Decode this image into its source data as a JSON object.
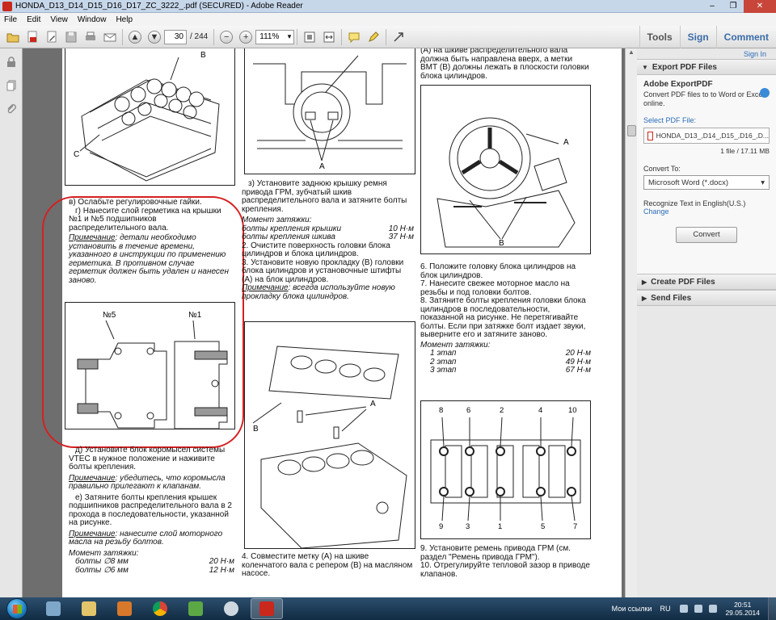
{
  "window": {
    "title": "HONDA_D13_D14_D15_D16_D17_ZC_3222_.pdf (SECURED) - Adobe Reader",
    "controls": [
      "–",
      "❐",
      "✕"
    ]
  },
  "menu": [
    "File",
    "Edit",
    "View",
    "Window",
    "Help"
  ],
  "toolbar": {
    "page_current": "30",
    "page_total": "/ 244",
    "zoom": "111%",
    "tools_label": "Tools",
    "sign_label": "Sign",
    "comment_label": "Comment"
  },
  "right_pane": {
    "sign_in": "Sign In",
    "export_header": "Export PDF Files",
    "export_title": "Adobe ExportPDF",
    "export_desc": "Convert PDF files to to Word or Excel online.",
    "select_label": "Select PDF File:",
    "file_name": "HONDA_D13_,D14_,D15_,D16_,D...",
    "file_count": "1 file / 17.11 MB",
    "convert_to_label": "Convert To:",
    "convert_to_value": "Microsoft Word (*.docx)",
    "recognize_text": "Recognize Text in English(U.S.)",
    "change_link": "Change",
    "convert_button": "Convert",
    "create_header": "Create PDF Files",
    "send_header": "Send Files"
  },
  "document": {
    "col1": {
      "fig_labels": [
        "В",
        "С"
      ],
      "p1": "в) Ослабьте регулировочные гайки.",
      "p2": "г) Нанесите слой герметика на крышки №1 и №5 подшипников распределительного вала.",
      "note1_label": "Примечание",
      "note1_text": ": детали необходимо установить в течение времени, указанного в инструкции по применению герметика. В противном случае герметик должен быть удален и нанесен заново.",
      "fig2_label_a": "№5",
      "fig2_label_b": "№1",
      "p3": "д) Установите блок коромысел системы VTEC в нужное положение и наживите болты крепления.",
      "note2_label": "Примечание",
      "note2_text": ": убедитесь, что коромысла правильно прилегают к клапанам.",
      "p4": "е) Затяните болты крепления крышек подшипников распределительного вала в 2 прохода в последовательности, указанной на рисунке.",
      "note3_label": "Примечание",
      "note3_text": ": нанесите слой моторного масла на резьбу болтов.",
      "torque_title": "Момент затяжки:",
      "torque_rows": [
        {
          "name": "болты ∅8 мм",
          "value": "20 Н·м"
        },
        {
          "name": "болты ∅6 мм",
          "value": "12 Н·м"
        }
      ]
    },
    "col2": {
      "fig_label_a": "A",
      "p1": "з) Установите заднюю крышку ремня привода ГРМ, зубчатый шкив распределительного вала и затяните болты крепления.",
      "torque_title": "Момент затяжки:",
      "torque_rows": [
        {
          "name": "болты крепления крышки",
          "value": "10 Н·м"
        },
        {
          "name": "болты крепления шкива",
          "value": "37 Н·м"
        }
      ],
      "p2": "2. Очистите поверхность головки блока цилиндров и блока цилиндров.",
      "p3": "3. Установите новую прокладку (В) головки блока цилиндров и установочные штифты (А) на блок цилиндров.",
      "note_label": "Примечание",
      "note_text": ": всегда используйте новую прокладку блока цилиндров.",
      "fig2_label_a": "A",
      "fig2_label_b": "B",
      "p4": "4. Совместите метку (А) на шкиве коленчатого вала с репером (В) на масляном насосе."
    },
    "col3": {
      "p0": "(А) на шкиве распределительного вала должна быть направлена вверх, а метки ВМТ (В) должны лежать в плоскости головки блока цилиндров.",
      "fig_label_a": "A",
      "fig_label_b": "B",
      "p1": "6. Положите головку блока цилиндров на блок цилиндров.",
      "p2": "7. Нанесите свежее моторное масло на резьбы и под головки болтов.",
      "p3": "8. Затяните болты крепления головки блока цилиндров в последовательности, показанной на рисунке. Не перетягивайте болты. Если при затяжке болт издает звуки, выверните его и затяните заново.",
      "torque_title": "Момент затяжки:",
      "torque_rows": [
        {
          "name": "1 этап",
          "value": "20 Н·м"
        },
        {
          "name": "2 этап",
          "value": "49 Н·м"
        },
        {
          "name": "3 этап",
          "value": "67 Н·м"
        }
      ],
      "bolt_top": [
        "8",
        "6",
        "2",
        "4",
        "10"
      ],
      "bolt_bottom": [
        "9",
        "3",
        "1",
        "5",
        "7"
      ],
      "p4": "9. Установите ремень привода ГРМ (см. раздел \"Ремень привода ГРМ\").",
      "p5": "10. Отрегулируйте тепловой зазор в приводе клапанов."
    }
  },
  "taskbar": {
    "links": "Мои ссылки",
    "lang": "RU",
    "time": "20:51",
    "date": "29.05.2014"
  },
  "colors": {
    "annotation_red": "#d42020",
    "acrobat_red": "#c9281c",
    "link_blue": "#2a6cb8"
  }
}
